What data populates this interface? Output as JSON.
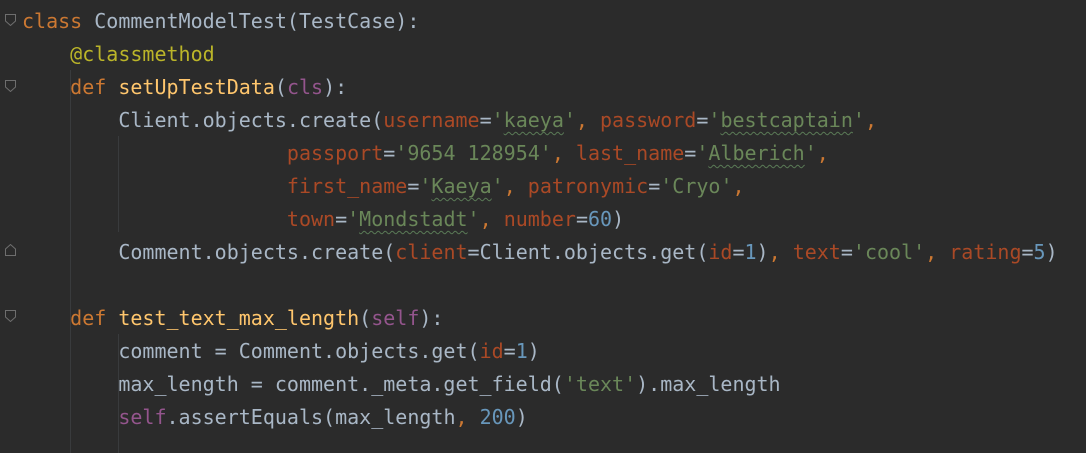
{
  "code": {
    "class_line": {
      "kw": "class",
      "name": "CommentModelTest",
      "open": "(",
      "base": "TestCase",
      "close": "):"
    },
    "decorator": "@classmethod",
    "def1": {
      "kw": "def",
      "name": "setUpTestData",
      "open": "(",
      "param": "cls",
      "close": "):"
    },
    "create_client": {
      "call": "Client.objects.create(",
      "k_username": "username",
      "eq": "=",
      "q": "'",
      "v_username": "kaeya",
      "comma": ", ",
      "k_password": "password",
      "v_password": "bestcaptain",
      "k_passport": "passport",
      "v_passport": "'9654 128954'",
      "k_last_name": "last_name",
      "v_last_name": "Alberich",
      "k_first_name": "first_name",
      "v_first_name": "Kaeya",
      "k_patronymic": "patronymic",
      "v_patronymic": "'Cryo'",
      "k_town": "town",
      "v_town": "Mondstadt",
      "k_number": "number",
      "v_number": "60",
      "close": ")"
    },
    "create_comment": {
      "call": "Comment.objects.create(",
      "k_client": "client",
      "v_client": "Client.objects.get(",
      "k_id": "id",
      "v_id": "1",
      "close_inner": ")",
      "k_text": "text",
      "v_text": "'cool'",
      "k_rating": "rating",
      "v_rating": "5",
      "close": ")"
    },
    "def2": {
      "kw": "def",
      "name": "test_text_max_length",
      "open": "(",
      "param": "self",
      "close": "):"
    },
    "body2": {
      "line1_lhs": "comment = Comment.objects.get(",
      "k_id": "id",
      "v_id": "1",
      "line1_close": ")",
      "line2_lhs": "max_length = comment._meta.get_field(",
      "v_field": "'text'",
      "line2_tail": ").max_length",
      "line3_self": "self",
      "line3_call": ".assertEquals(max_length",
      "v_expected": "200",
      "line3_close": ")"
    }
  },
  "colors": {
    "background": "#2b2b2b",
    "text": "#a9b7c6",
    "keyword": "#cc7832",
    "function": "#ffc66d",
    "decorator": "#bbb529",
    "self": "#94558d",
    "parameter": "#aa4926",
    "string": "#6a8759",
    "number": "#6897bb"
  }
}
